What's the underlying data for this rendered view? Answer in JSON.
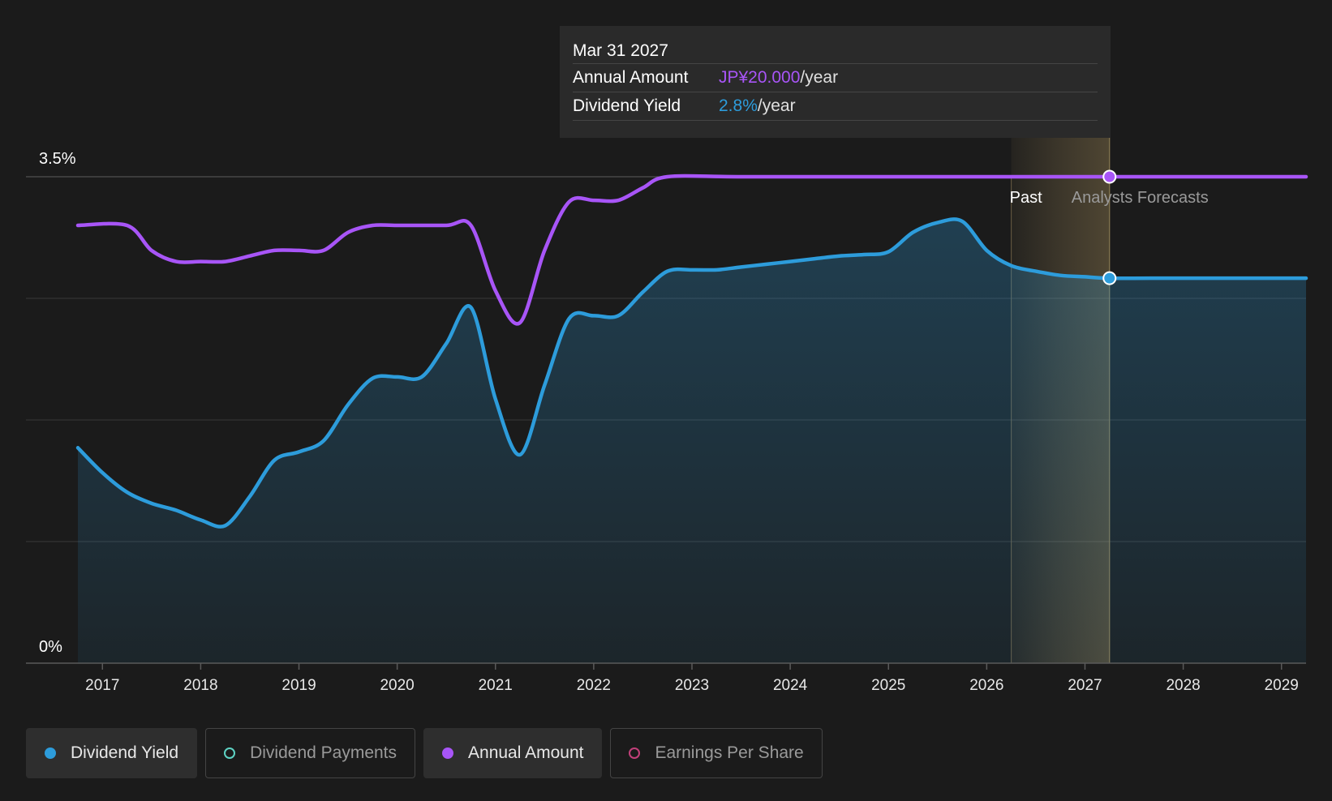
{
  "tooltip": {
    "date": "Mar 31 2027",
    "rows": [
      {
        "label": "Annual Amount",
        "value": "JP¥20.000",
        "unit": "/year",
        "color": "#a855f7"
      },
      {
        "label": "Dividend Yield",
        "value": "2.8%",
        "unit": "/year",
        "color": "#2d9cdb"
      }
    ]
  },
  "regions": {
    "past_label": "Past",
    "forecast_label": "Analysts Forecasts"
  },
  "legend": [
    {
      "label": "Dividend Yield",
      "color": "#2d9cdb",
      "active": true
    },
    {
      "label": "Dividend Payments",
      "color": "#5ed3c4",
      "active": false
    },
    {
      "label": "Annual Amount",
      "color": "#a855f7",
      "active": true
    },
    {
      "label": "Earnings Per Share",
      "color": "#c2407a",
      "active": false
    }
  ],
  "chart_data": {
    "type": "line",
    "y_tick_labels": [
      "0%",
      "3.5%"
    ],
    "ylim": [
      0,
      3.5
    ],
    "xlim": [
      2016.75,
      2029.25
    ],
    "x_ticks": [
      2017,
      2018,
      2019,
      2020,
      2021,
      2022,
      2023,
      2024,
      2025,
      2026,
      2027,
      2028,
      2029
    ],
    "grid": true,
    "legend_position": "bottom",
    "past_forecast_boundary": 2026.25,
    "forecast_band": [
      2026.25,
      2027.25
    ],
    "highlight_x": 2027.25,
    "series": [
      {
        "name": "Dividend Yield",
        "color": "#2d9cdb",
        "area": true,
        "points": [
          [
            2016.75,
            1.55
          ],
          [
            2017.0,
            1.37
          ],
          [
            2017.25,
            1.23
          ],
          [
            2017.5,
            1.15
          ],
          [
            2017.75,
            1.1
          ],
          [
            2018.0,
            1.03
          ],
          [
            2018.25,
            0.99
          ],
          [
            2018.5,
            1.2
          ],
          [
            2018.75,
            1.46
          ],
          [
            2019.0,
            1.52
          ],
          [
            2019.25,
            1.6
          ],
          [
            2019.5,
            1.86
          ],
          [
            2019.75,
            2.05
          ],
          [
            2020.0,
            2.06
          ],
          [
            2020.25,
            2.06
          ],
          [
            2020.5,
            2.3
          ],
          [
            2020.75,
            2.56
          ],
          [
            2021.0,
            1.9
          ],
          [
            2021.25,
            1.5
          ],
          [
            2021.5,
            2.0
          ],
          [
            2021.75,
            2.48
          ],
          [
            2022.0,
            2.5
          ],
          [
            2022.25,
            2.5
          ],
          [
            2022.5,
            2.67
          ],
          [
            2022.75,
            2.82
          ],
          [
            2023.0,
            2.83
          ],
          [
            2023.25,
            2.83
          ],
          [
            2023.5,
            2.85
          ],
          [
            2023.75,
            2.87
          ],
          [
            2024.0,
            2.89
          ],
          [
            2024.25,
            2.91
          ],
          [
            2024.5,
            2.93
          ],
          [
            2024.75,
            2.94
          ],
          [
            2025.0,
            2.96
          ],
          [
            2025.25,
            3.1
          ],
          [
            2025.5,
            3.17
          ],
          [
            2025.75,
            3.18
          ],
          [
            2026.0,
            2.97
          ],
          [
            2026.25,
            2.86
          ],
          [
            2026.5,
            2.82
          ],
          [
            2026.75,
            2.79
          ],
          [
            2027.0,
            2.78
          ],
          [
            2027.25,
            2.77
          ],
          [
            2028.0,
            2.77
          ],
          [
            2029.25,
            2.77
          ]
        ]
      },
      {
        "name": "Annual Amount",
        "color": "#a855f7",
        "area": false,
        "points": [
          [
            2016.75,
            3.15
          ],
          [
            2017.25,
            3.15
          ],
          [
            2017.5,
            2.97
          ],
          [
            2017.75,
            2.89
          ],
          [
            2018.0,
            2.89
          ],
          [
            2018.25,
            2.89
          ],
          [
            2018.5,
            2.93
          ],
          [
            2018.75,
            2.97
          ],
          [
            2019.0,
            2.97
          ],
          [
            2019.25,
            2.97
          ],
          [
            2019.5,
            3.1
          ],
          [
            2019.75,
            3.15
          ],
          [
            2020.0,
            3.15
          ],
          [
            2020.5,
            3.15
          ],
          [
            2020.75,
            3.15
          ],
          [
            2021.0,
            2.68
          ],
          [
            2021.25,
            2.45
          ],
          [
            2021.5,
            2.97
          ],
          [
            2021.75,
            3.32
          ],
          [
            2022.0,
            3.33
          ],
          [
            2022.25,
            3.33
          ],
          [
            2022.5,
            3.42
          ],
          [
            2022.75,
            3.5
          ],
          [
            2023.5,
            3.5
          ],
          [
            2025.0,
            3.5
          ],
          [
            2026.5,
            3.5
          ],
          [
            2027.25,
            3.5
          ],
          [
            2028.0,
            3.5
          ],
          [
            2029.25,
            3.5
          ]
        ]
      }
    ]
  }
}
